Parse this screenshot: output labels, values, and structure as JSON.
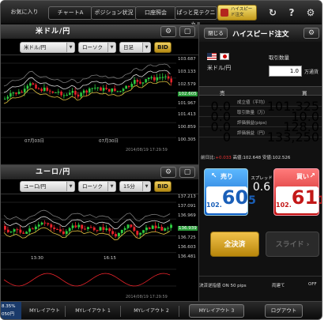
{
  "topbar": {
    "tabs": [
      "お気に入り",
      "チャートA",
      "ポジション状況",
      "口座照会",
      "ぱっと見テクニカル"
    ],
    "highspeed_btn": "ハイスピード注文",
    "icons": {
      "refresh": "↻",
      "help": "?",
      "settings": "⚙"
    }
  },
  "chart1": {
    "title": "米ドル/円",
    "pair": "米ドル/円",
    "type": "ローソク",
    "period": "日足",
    "price_type": "BID",
    "y_labels": [
      "103.687",
      "103.133",
      "102.579",
      "101.967",
      "101.413",
      "100.859",
      "100.305"
    ],
    "current_price": "102.605",
    "x_labels": [
      "07月03日",
      "07月30日"
    ],
    "timestamp": "2014/08/19 17:29:59"
  },
  "chart2": {
    "title": "ユーロ/円",
    "pair": "ユーロ/円",
    "type": "ローソク",
    "period": "15分",
    "price_type": "BID",
    "y_labels": [
      "137.213",
      "137.091",
      "136.969",
      "136.847",
      "136.725",
      "136.603",
      "136.481"
    ],
    "current_price": "136.939",
    "x_labels": [
      "13:30",
      "16:15"
    ],
    "timestamp": "2014/08/19 17:29:59"
  },
  "order": {
    "close_btn": "閉じる",
    "title": "ハイスピード注文",
    "pair_name": "米ドル/円",
    "qty_label": "取引数量",
    "qty_value": "1.0",
    "qty_unit": "万通貨",
    "sell_header": "売",
    "buy_header": "買",
    "rows": [
      {
        "left": "0.0",
        "label": "成立値（平均）",
        "right": "101.325"
      },
      {
        "left": "0.0",
        "label": "取引数量（万）",
        "right": "10.0"
      },
      {
        "left": "0.0",
        "label": "評価損益(pips)",
        "right": "128.0"
      },
      {
        "left": "0",
        "label": "評価損益（円）",
        "right": "133,250"
      }
    ],
    "change_label": "前日比:",
    "change_value": "+0.033",
    "high_label": "高値:",
    "high_value": "102.648",
    "low_label": "安値:",
    "low_value": "102.526",
    "sell_label": "売り",
    "sell_price_small": "102.",
    "sell_price_big": "60",
    "sell_price_last": "5",
    "spread_label": "スプレッド",
    "spread_value": "0.6",
    "buy_label": "買い",
    "buy_price_small": "102.",
    "buy_price_big": "61",
    "buy_price_last": "1",
    "settle_all": "全決済",
    "slide": "スライド",
    "reverse_label": "決済逆指値 ON 50 pips",
    "both_label": "両建て",
    "both_value": "OFF"
  },
  "bottombar": {
    "left_value1": "8.35%",
    "left_value2": "050円",
    "layouts": [
      "MYレイアウト",
      "MYレイアウト 1",
      "MYレイアウト 2",
      "MYレイアウト 3"
    ],
    "logout": "ログアウト"
  },
  "colors": {
    "up": "#2ecc40",
    "down": "#e8232a",
    "sell_blue": "#1e7ad8",
    "buy_red": "#e02a2a",
    "gold": "#d9a520"
  }
}
